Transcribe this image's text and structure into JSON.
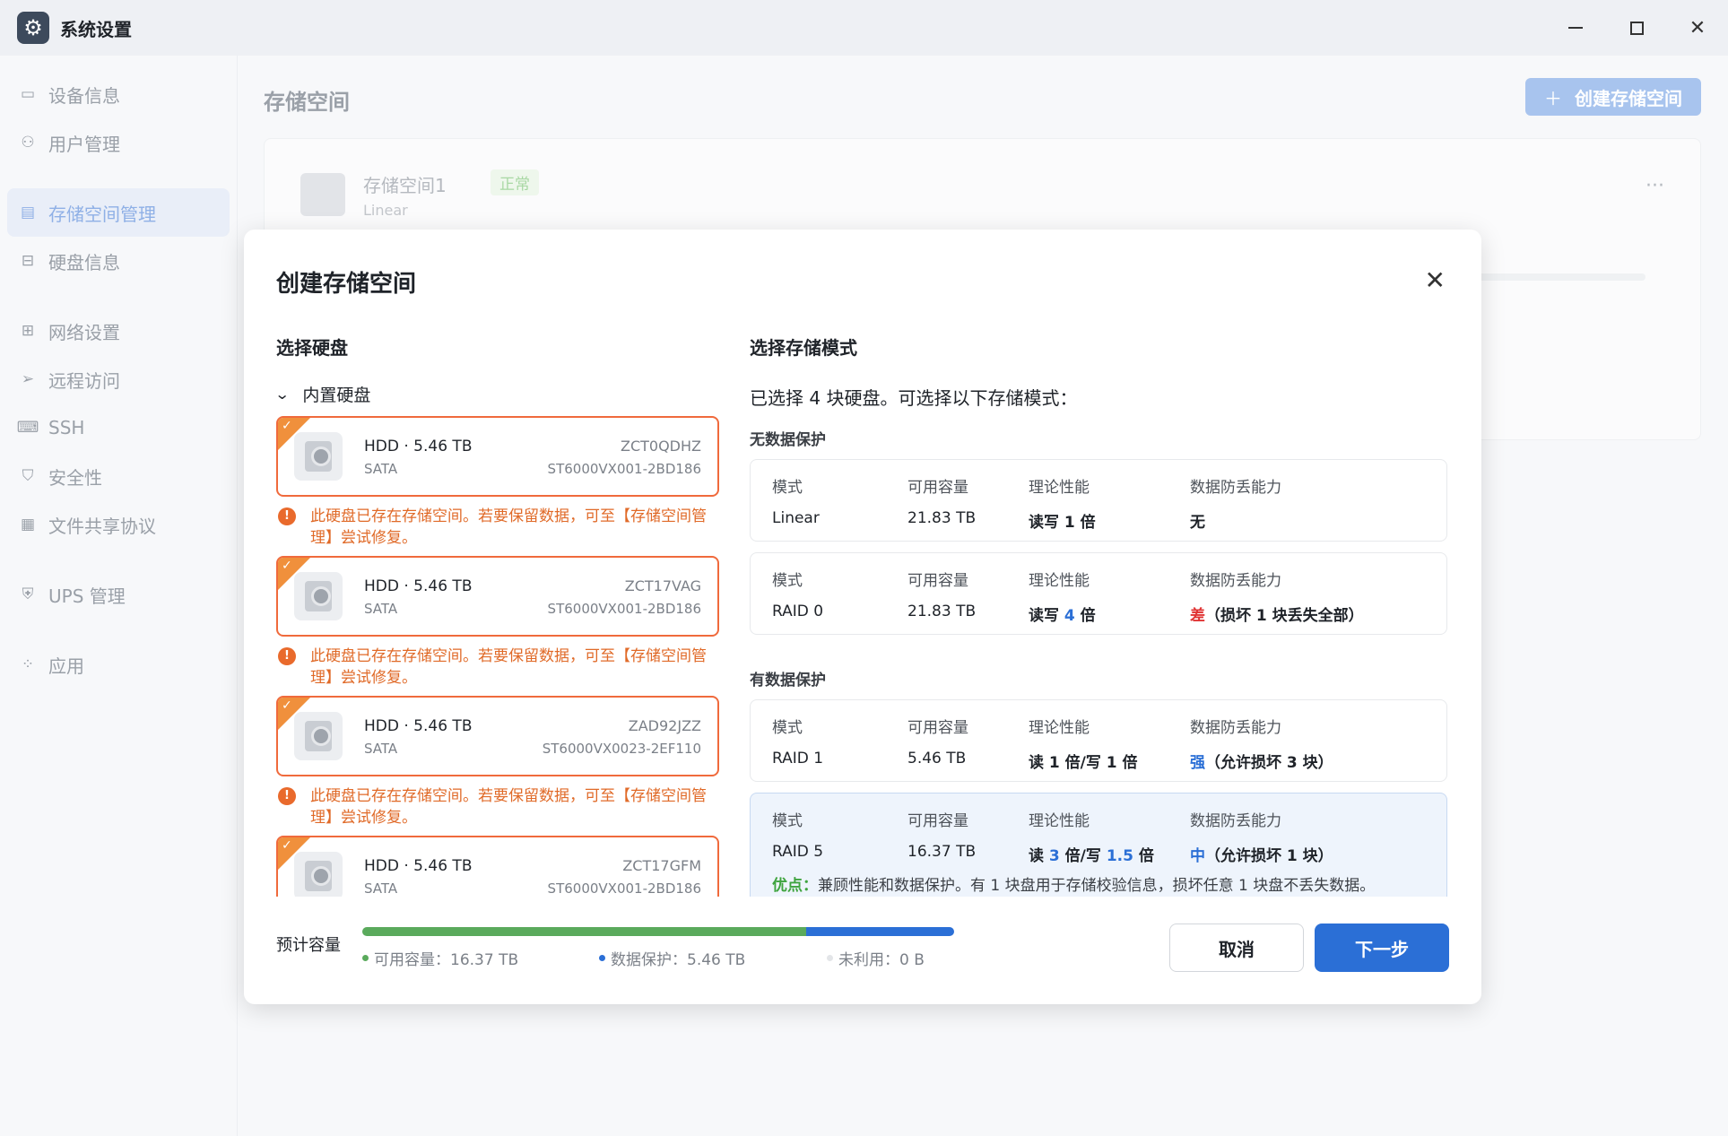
{
  "window": {
    "title": "系统设置"
  },
  "sidebar": {
    "items": [
      {
        "label": "设备信息",
        "icon": "device-icon"
      },
      {
        "label": "用户管理",
        "icon": "user-icon"
      },
      {
        "label": "存储空间管理",
        "icon": "storage-icon",
        "active": true
      },
      {
        "label": "硬盘信息",
        "icon": "disk-icon"
      },
      {
        "label": "网络设置",
        "icon": "network-icon"
      },
      {
        "label": "远程访问",
        "icon": "remote-icon"
      },
      {
        "label": "SSH",
        "icon": "ssh-icon"
      },
      {
        "label": "安全性",
        "icon": "shield-icon"
      },
      {
        "label": "文件共享协议",
        "icon": "file-share-icon"
      },
      {
        "label": "UPS 管理",
        "icon": "ups-icon"
      },
      {
        "label": "应用",
        "icon": "apps-icon"
      }
    ]
  },
  "main": {
    "title": "存储空间",
    "create_button": "创建存储空间",
    "space": {
      "name": "存储空间1",
      "status": "正常",
      "type": "Linear"
    }
  },
  "modal": {
    "title": "创建存储空间",
    "disks_header": "选择硬盘",
    "internal_label": "内置硬盘",
    "warning": "此硬盘已存在存储空间。若要保留数据，可至【存储空间管理】尝试修复。",
    "disks": [
      {
        "name": "HDD · 5.46 TB",
        "bus": "SATA",
        "sn": "ZCT0QDHZ",
        "model": "ST6000VX001-2BD186"
      },
      {
        "name": "HDD · 5.46 TB",
        "bus": "SATA",
        "sn": "ZCT17VAG",
        "model": "ST6000VX001-2BD186"
      },
      {
        "name": "HDD · 5.46 TB",
        "bus": "SATA",
        "sn": "ZAD92JZZ",
        "model": "ST6000VX0023-2EF110"
      },
      {
        "name": "HDD · 5.46 TB",
        "bus": "SATA",
        "sn": "ZCT17GFM",
        "model": "ST6000VX001-2BD186"
      }
    ],
    "modes_header": "选择存储模式",
    "modes_intro": "已选择 4 块硬盘。可选择以下存储模式：",
    "col_labels": {
      "mode": "模式",
      "capacity": "可用容量",
      "perf": "理论性能",
      "protect": "数据防丢能力"
    },
    "no_protect_header": "无数据保护",
    "protect_header": "有数据保护",
    "modes": {
      "linear": {
        "mode": "Linear",
        "capacity": "21.83 TB",
        "perf": "读写 1 倍",
        "protect": "无"
      },
      "raid0": {
        "mode": "RAID 0",
        "capacity": "21.83 TB",
        "perf_a": "读写 ",
        "perf_b": "4",
        "perf_c": " 倍",
        "protect_a": "差",
        "protect_b": "（损坏 1 块丢失全部）"
      },
      "raid1": {
        "mode": "RAID 1",
        "capacity": "5.46 TB",
        "perf": "读 1 倍/写 1 倍",
        "protect_a": "强",
        "protect_b": "（允许损坏 3 块）"
      },
      "raid5": {
        "mode": "RAID 5",
        "capacity": "16.37 TB",
        "perf_a": "读 ",
        "perf_b": "3",
        "perf_c": " 倍/写 ",
        "perf_d": "1.5",
        "perf_e": " 倍",
        "protect_a": "中",
        "protect_b": "（允许损坏 1 块）",
        "adv_label": "优点：",
        "adv_text": "兼顾性能和数据保护。有 1 块盘用于存储校验信息，损坏任意 1 块盘不丢失数据。"
      }
    },
    "capacity": {
      "label": "预计容量",
      "usable": "可用容量：16.37 TB",
      "protect": "数据保护：5.46 TB",
      "unused": "未利用：0 B",
      "usable_fraction": 0.75,
      "protect_fraction": 0.25
    },
    "cancel": "取消",
    "next": "下一步"
  },
  "colors": {
    "accent": "#2b6fd6",
    "warning": "#e06a28",
    "usable": "#5aaa5c"
  }
}
